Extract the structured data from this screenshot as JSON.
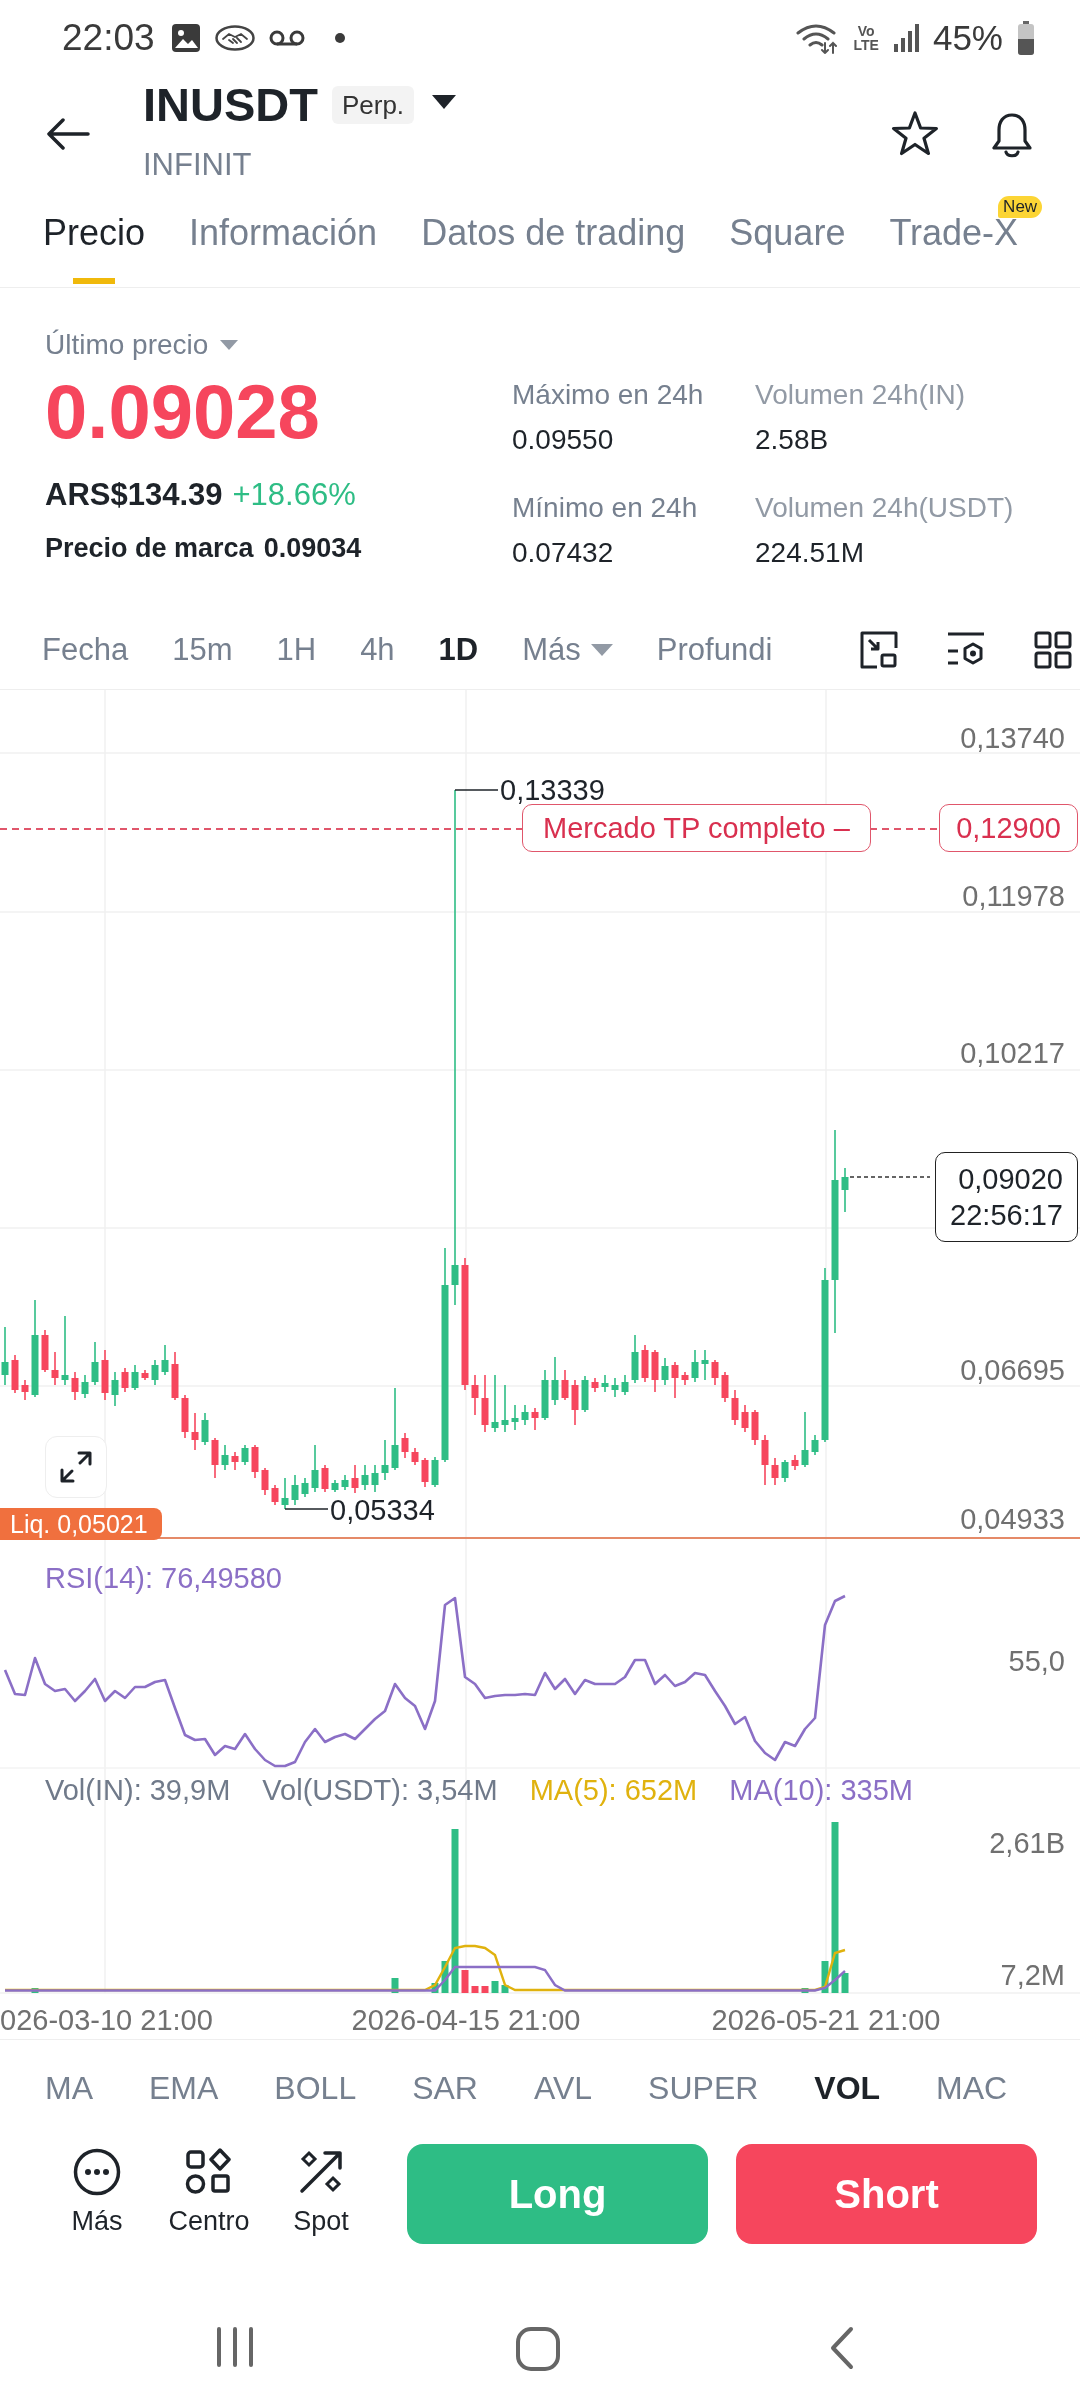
{
  "status_bar": {
    "time": "22:03",
    "voice_label": "Vo",
    "network_label": "LTE",
    "battery": "45%"
  },
  "header": {
    "symbol": "INUSDT",
    "badge": "Perp.",
    "subtitle": "INFINIT"
  },
  "tabs": [
    {
      "label": "Precio",
      "selected": true
    },
    {
      "label": "Información",
      "selected": false
    },
    {
      "label": "Datos de trading",
      "selected": false
    },
    {
      "label": "Square",
      "selected": false
    },
    {
      "label": "Trade-X",
      "selected": false,
      "badge": "New"
    }
  ],
  "price_panel": {
    "label": "Último precio",
    "last_price": "0.09028",
    "fiat_price": "ARS$134.39",
    "change": "+18.66%",
    "mark_label": "Precio de marca",
    "mark_price": "0.09034",
    "stats": [
      {
        "label": "Máximo en 24h",
        "value": "0.09550"
      },
      {
        "label": "Volumen 24h(IN)",
        "value": "2.58B"
      },
      {
        "label": "Mínimo en 24h",
        "value": "0.07432"
      },
      {
        "label": "Volumen 24h(USDT)",
        "value": "224.51M"
      }
    ]
  },
  "intervals": [
    {
      "label": "Fecha",
      "selected": false,
      "dropdown": false
    },
    {
      "label": "15m",
      "selected": false,
      "dropdown": false
    },
    {
      "label": "1H",
      "selected": false,
      "dropdown": false
    },
    {
      "label": "4h",
      "selected": false,
      "dropdown": false
    },
    {
      "label": "1D",
      "selected": true,
      "dropdown": false
    },
    {
      "label": "Más",
      "selected": false,
      "dropdown": true
    },
    {
      "label": "Profundi",
      "selected": false,
      "dropdown": false
    }
  ],
  "chart": {
    "price_ticks": [
      "0,13740",
      "0,11978",
      "0,10217",
      "0,06695",
      "0,04933"
    ],
    "high_label": "0,13339",
    "low_label": "0,05334",
    "order_label": "Mercado TP completo –",
    "order_price": "0,12900",
    "last_price": "0,09020",
    "countdown": "22:56:17",
    "liquidation_label": "Liq. 0,05021"
  },
  "rsi": {
    "label": "RSI(14): 76,49580",
    "tick": "55,0"
  },
  "volume": {
    "legend": [
      {
        "text": "Vol(IN): 39,9M",
        "color": "#707a8a"
      },
      {
        "text": "Vol(USDT): 3,54M",
        "color": "#707a8a"
      },
      {
        "text": "MA(5): 652M",
        "color": "#e0b20e"
      },
      {
        "text": "MA(10): 335M",
        "color": "#8b6fc6"
      }
    ],
    "ticks": [
      "2,61B",
      "7,2M"
    ]
  },
  "dates": [
    "026-03-10 21:00",
    "2026-04-15 21:00",
    "2026-05-21 21:00"
  ],
  "indicators": [
    {
      "label": "MA",
      "selected": false
    },
    {
      "label": "EMA",
      "selected": false
    },
    {
      "label": "BOLL",
      "selected": false
    },
    {
      "label": "SAR",
      "selected": false
    },
    {
      "label": "AVL",
      "selected": false
    },
    {
      "label": "SUPER",
      "selected": false
    }
  ],
  "sub_indicators": [
    {
      "label": "VOL",
      "selected": true
    },
    {
      "label": "MAC",
      "selected": false
    }
  ],
  "actions": [
    {
      "label": "Más"
    },
    {
      "label": "Centro"
    },
    {
      "label": "Spot"
    }
  ],
  "trade_buttons": [
    {
      "label": "Long",
      "kind": "long"
    },
    {
      "label": "Short",
      "kind": "short"
    }
  ]
}
